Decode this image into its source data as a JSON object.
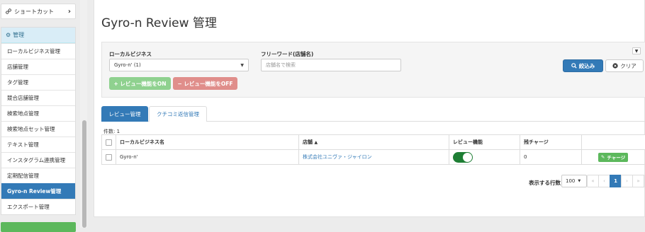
{
  "sidebar": {
    "shortcut_label": "ショートカット",
    "section_label": "管理",
    "items": [
      {
        "label": "ローカルビジネス管理"
      },
      {
        "label": "店舗管理"
      },
      {
        "label": "タグ管理"
      },
      {
        "label": "競合店舗管理"
      },
      {
        "label": "検索地点管理"
      },
      {
        "label": "検索地点セット管理"
      },
      {
        "label": "テキスト管理"
      },
      {
        "label": "インスタグラム連携管理"
      },
      {
        "label": "定期配信管理"
      },
      {
        "label": "Gyro-n Review管理",
        "active": true
      },
      {
        "label": "エクスポート管理"
      }
    ]
  },
  "page": {
    "title": "Gyro-n Review 管理"
  },
  "filter": {
    "local_business_label": "ローカルビジネス",
    "local_business_value": "Gyro-n' (1)",
    "freeword_label": "フリーワード(店舗名)",
    "freeword_placeholder": "店舗名で検索",
    "freeword_value": "",
    "review_on_label": "+ レビュー機能をON",
    "review_off_label": "− レビュー機能をOFF",
    "search_label": "絞込み",
    "clear_label": "クリア"
  },
  "tabs": [
    {
      "label": "レビュー管理",
      "active": true
    },
    {
      "label": "クチコミ返信管理",
      "active": false
    }
  ],
  "table": {
    "count_text": "件数: 1",
    "headers": {
      "local_business": "ローカルビジネス名",
      "store": "店舗",
      "review_feature": "レビュー機能",
      "remaining_charge": "残チャージ"
    },
    "rows": [
      {
        "local_business": "Gyro-n'",
        "store": "株式会社ユニヴァ・ジャイロン",
        "review_enabled": true,
        "remaining_charge": "0",
        "charge_label": "チャージ"
      }
    ]
  },
  "pagination": {
    "rows_label": "表示する行数",
    "rows_per_page": "100",
    "first": "«",
    "prev": "‹",
    "current": "1",
    "next": "›",
    "last": "»"
  },
  "colors": {
    "primary": "#337ab7",
    "success": "#5cb85c",
    "danger": "#d9534f",
    "toggle_on": "#1e7e34"
  }
}
